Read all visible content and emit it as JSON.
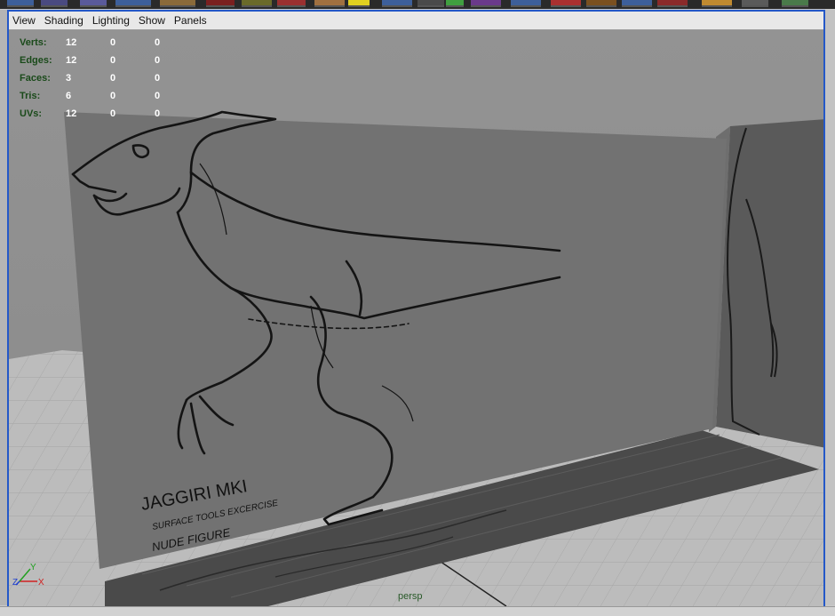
{
  "menu": [
    "View",
    "Shading",
    "Lighting",
    "Show",
    "Panels"
  ],
  "hud": {
    "rows": [
      {
        "label": "Verts:",
        "v1": "12",
        "v2": "0",
        "v3": "0"
      },
      {
        "label": "Edges:",
        "v1": "12",
        "v2": "0",
        "v3": "0"
      },
      {
        "label": "Faces:",
        "v1": "3",
        "v2": "0",
        "v3": "0"
      },
      {
        "label": "Tris:",
        "v1": "6",
        "v2": "0",
        "v3": "0"
      },
      {
        "label": "UVs:",
        "v1": "12",
        "v2": "0",
        "v3": "0"
      }
    ]
  },
  "reference_text": {
    "title": "JAGGIRI MKI",
    "line1": "SURFACE TOOLS EXCERCISE",
    "line2": "NUDE FIGURE"
  },
  "camera_label": "persp",
  "axis": {
    "x": "X",
    "y": "Y",
    "z": "Z"
  },
  "colors": {
    "active_border": "#2458c8",
    "hud_label": "#1a4a1a",
    "hud_value": "#ffffff"
  }
}
